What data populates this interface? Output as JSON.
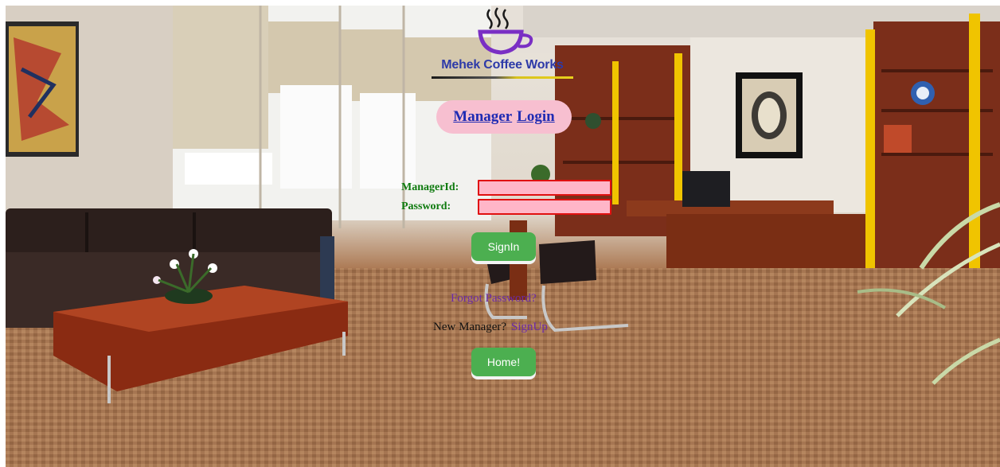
{
  "brand": {
    "name": "Mehek Coffee Works"
  },
  "header": {
    "title_word_1": "Manager",
    "title_word_2": "Login"
  },
  "form": {
    "manager_id_label": "ManagerId:",
    "manager_id_value": "",
    "password_label": "Password:",
    "password_value": "",
    "signin_label": "SignIn"
  },
  "links": {
    "forgot_password": "Forgot Password?",
    "new_manager_prompt": "New Manager?",
    "signup": "SignUp"
  },
  "footer": {
    "home_label": "Home!"
  },
  "colors": {
    "title_pill": "#f7bfd0",
    "title_link": "#1f2bb3",
    "label_green": "#0e7a0e",
    "input_fill": "#ffb6c8",
    "input_border": "#e01010",
    "button_green": "#4caf50",
    "link_purple": "#6a2aa8",
    "brand_blue": "#2d3aa8",
    "cup_purple": "#7a2fc4"
  },
  "icons": {
    "logo": "coffee-cup-icon"
  }
}
